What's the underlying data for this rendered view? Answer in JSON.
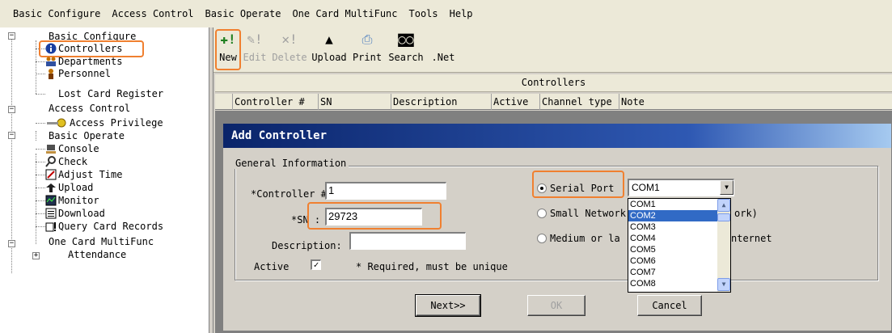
{
  "menubar": [
    {
      "label": "Basic Configure"
    },
    {
      "label": "Access Control"
    },
    {
      "label": "Basic Operate"
    },
    {
      "label": "One Card MultiFunc"
    },
    {
      "label": "Tools"
    },
    {
      "label": "Help"
    }
  ],
  "tree": {
    "basic_configure": "Basic Configure",
    "controllers": "Controllers",
    "departments": "Departments",
    "personnel": "Personnel",
    "lost_card": "Lost Card Register",
    "access_control": "Access Control",
    "access_privilege": "Access Privilege",
    "basic_operate": "Basic Operate",
    "console": "Console",
    "check": "Check",
    "adjust_time": "Adjust Time",
    "upload": "Upload",
    "monitor": "Monitor",
    "download": "Download",
    "query_card_records": "Query Card Records",
    "one_card": "One Card MultiFunc",
    "attendance": "Attendance"
  },
  "toolbar": {
    "new": "New",
    "edit": "Edit",
    "delete": "Delete",
    "upload": "Upload",
    "print": "Print",
    "search": "Search",
    "net": ".Net"
  },
  "grid": {
    "title": "Controllers",
    "columns": [
      "Controller #",
      "SN",
      "Description",
      "Active",
      "Channel type",
      "Note"
    ]
  },
  "dialog": {
    "title": "Add Controller",
    "group_label": "General Information",
    "controller_no_label": "*Controller #:",
    "controller_no_value": "1",
    "sn_label": "*SN :",
    "sn_value": "29723",
    "description_label": "Description:",
    "description_value": "",
    "active_label": "Active",
    "active_checked": "✓",
    "required_note": "*  Required, must be unique",
    "serial_port_label": "Serial Port",
    "small_network_label": "Small Network",
    "small_network_suffix": "ork)",
    "medium_label": "Medium or la",
    "medium_suffix": "nternet",
    "combo_value": "COM1",
    "com_options": [
      "COM1",
      "COM2",
      "COM3",
      "COM4",
      "COM5",
      "COM6",
      "COM7",
      "COM8"
    ],
    "com_selected_index": 1,
    "next_button": "Next>>",
    "ok_button": "OK",
    "cancel_button": "Cancel"
  },
  "colors": {
    "highlight_box": "#f08030",
    "title_bar": "#0a246a",
    "selection": "#316ac5"
  }
}
